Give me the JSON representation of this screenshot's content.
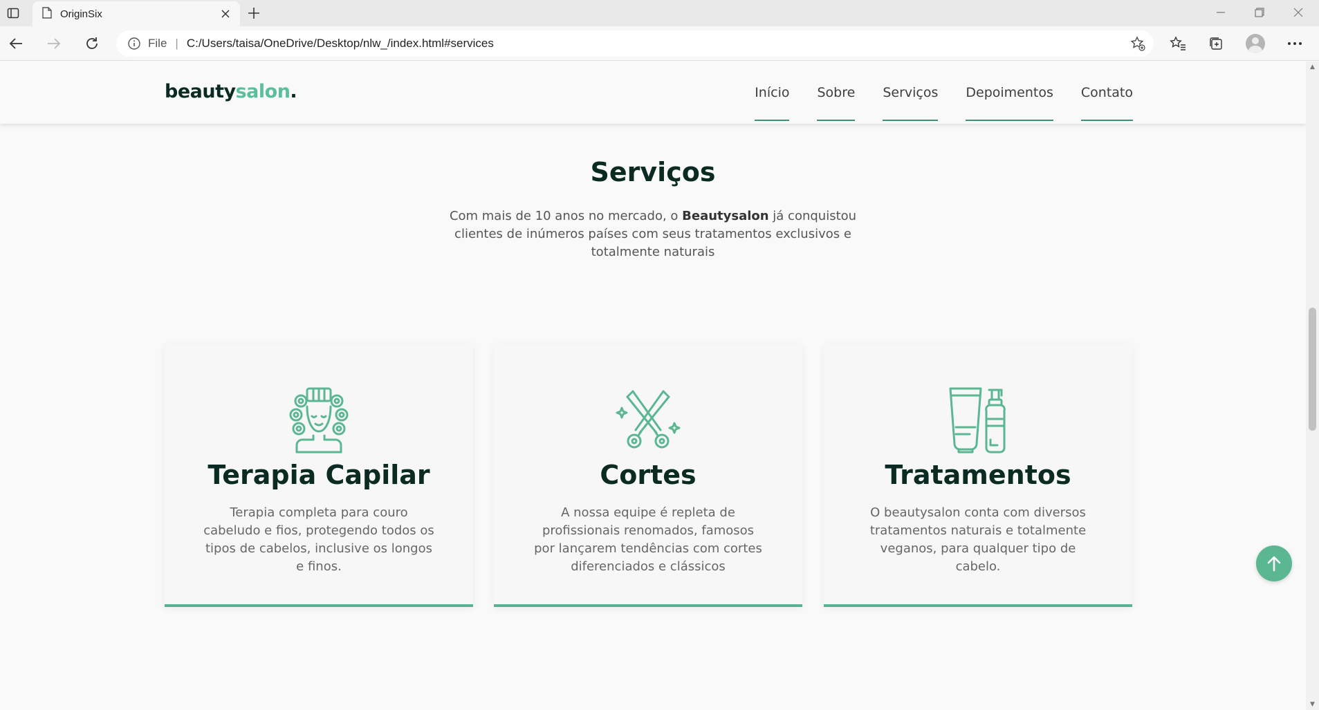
{
  "browser": {
    "tab_title": "OriginSix",
    "address_prefix": "File",
    "address_separator": "|",
    "url": "C:/Users/taisa/OneDrive/Desktop/nlw_/index.html#services"
  },
  "site": {
    "logo_main": "beauty",
    "logo_accent": "salon",
    "logo_dot": ".",
    "nav": [
      "Início",
      "Sobre",
      "Serviços",
      "Depoimentos",
      "Contato"
    ]
  },
  "services": {
    "title": "Serviços",
    "text_before": "Com mais de 10 anos no mercado, o ",
    "text_bold": "Beautysalon",
    "text_after": " já conquistou clientes de inúmeros países com seus tratamentos exclusivos e totalmente naturais",
    "cards": [
      {
        "icon": "hair-curlers-icon",
        "title": "Terapia Capilar",
        "text": "Terapia completa para couro cabeludo e fios, protegendo todos os tipos de cabelos, inclusive os longos e finos."
      },
      {
        "icon": "scissors-icon",
        "title": "Cortes",
        "text": "A nossa equipe é repleta de profissionais renomados, famosos por lançarem tendências com cortes diferenciados e clássicos"
      },
      {
        "icon": "hair-products-icon",
        "title": "Tratamentos",
        "text": "O beautysalon conta com diversos tratamentos naturais e totalmente veganos, para qualquer tipo de cabelo."
      }
    ]
  },
  "colors": {
    "accent": "#5bbf9b",
    "dark": "#0a2a22",
    "card_border": "#59b291"
  }
}
